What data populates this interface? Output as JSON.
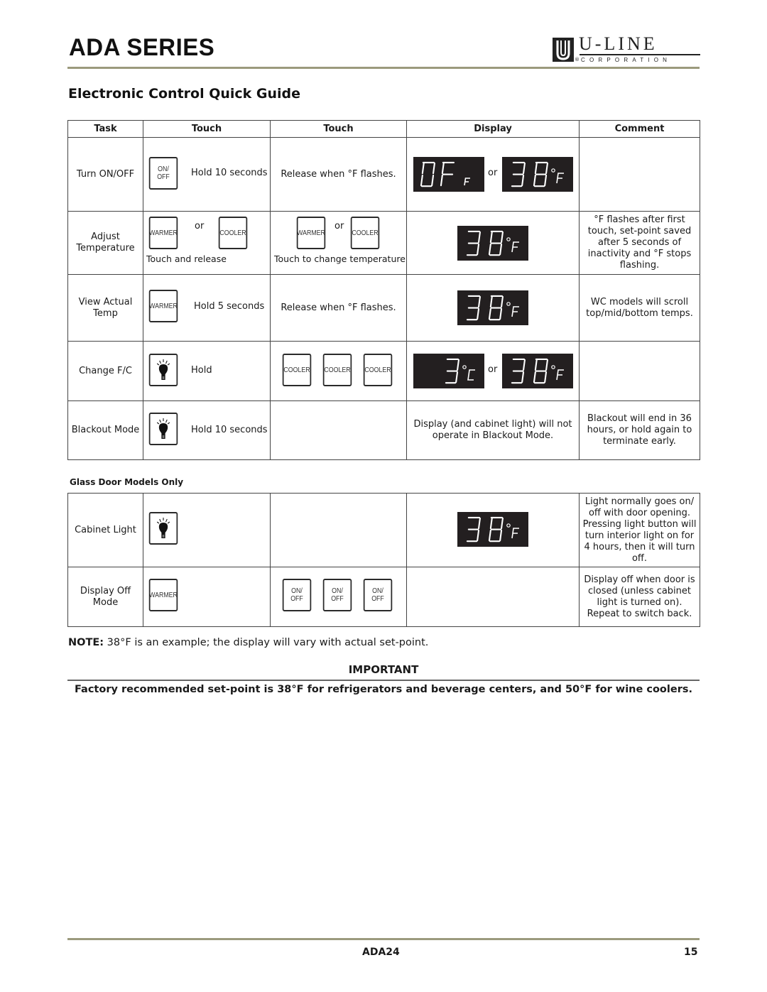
{
  "header": {
    "series_title": "ADA SERIES",
    "logo_word": "U-LINE",
    "logo_sub": "CORPORATION",
    "logo_reg": "®"
  },
  "guide_title": "Electronic Control Quick Guide",
  "table": {
    "columns": [
      "Task",
      "Touch",
      "Touch",
      "Display",
      "Comment"
    ],
    "rows": [
      {
        "task": "Turn ON/OFF",
        "touch1_keys": [
          "ON/\nOFF"
        ],
        "touch1_text": "Hold 10 seconds",
        "touch2_text": "Release when °F flashes.",
        "display": [
          "OFF",
          "38°F"
        ],
        "display_or": "or",
        "comment": ""
      },
      {
        "task": "Adjust Temperature",
        "touch1_keys": [
          "WARMER",
          "COOLER"
        ],
        "touch1_or": "or",
        "touch1_text": "Touch and release",
        "touch2_keys": [
          "WARMER",
          "COOLER"
        ],
        "touch2_or": "or",
        "touch2_text": "Touch to change temperature",
        "display": [
          "38°F"
        ],
        "comment": "°F flashes after first touch, set-point saved after 5 seconds of inactivity and °F stops flashing."
      },
      {
        "task": "View Actual Temp",
        "touch1_keys": [
          "WARMER"
        ],
        "touch1_text": "Hold 5 seconds",
        "touch2_text": "Release when °F flashes.",
        "display": [
          "38°F"
        ],
        "comment": "WC models will scroll top/mid/bottom temps."
      },
      {
        "task": "Change F/C",
        "touch1_keys": [
          "light-bulb"
        ],
        "touch1_text": "Hold",
        "touch2_keys": [
          "COOLER",
          "COOLER",
          "COOLER"
        ],
        "display": [
          "3°C",
          "38°F"
        ],
        "display_or": "or",
        "comment": ""
      },
      {
        "task": "Blackout Mode",
        "touch1_keys": [
          "light-bulb"
        ],
        "touch1_text": "Hold 10 seconds",
        "touch2_text": "",
        "display_text": "Display (and cabinet light) will not operate in Blackout Mode.",
        "comment": "Blackout will end in 36 hours, or hold again to terminate early."
      }
    ]
  },
  "glass": {
    "label": "Glass Door Models Only",
    "rows": [
      {
        "task": "Cabinet Light",
        "touch1_keys": [
          "light-bulb"
        ],
        "display": [
          "38°F"
        ],
        "comment": "Light normally goes on/ off with door opening. Pressing light button will turn interior light on for 4 hours, then it will turn off."
      },
      {
        "task": "Display Off Mode",
        "touch1_keys": [
          "WARMER"
        ],
        "touch2_keys": [
          "ON/\nOFF",
          "ON/\nOFF",
          "ON/\nOFF"
        ],
        "comment": "Display off when door is closed (unless cabinet light is turned on). Repeat to switch back."
      }
    ]
  },
  "note": {
    "label": "NOTE:",
    "text": " 38°F is an example; the display will vary with actual set-point."
  },
  "important": {
    "heading": "IMPORTANT",
    "text": "Factory recommended set-point is 38°F for refrigerators and beverage centers, and 50°F for wine coolers."
  },
  "footer": {
    "model": "ADA24",
    "page": "15"
  },
  "colors": {
    "rule": "#9b9a7d",
    "lcd_bg": "#231f20",
    "lcd_fg": "#ffffff"
  }
}
